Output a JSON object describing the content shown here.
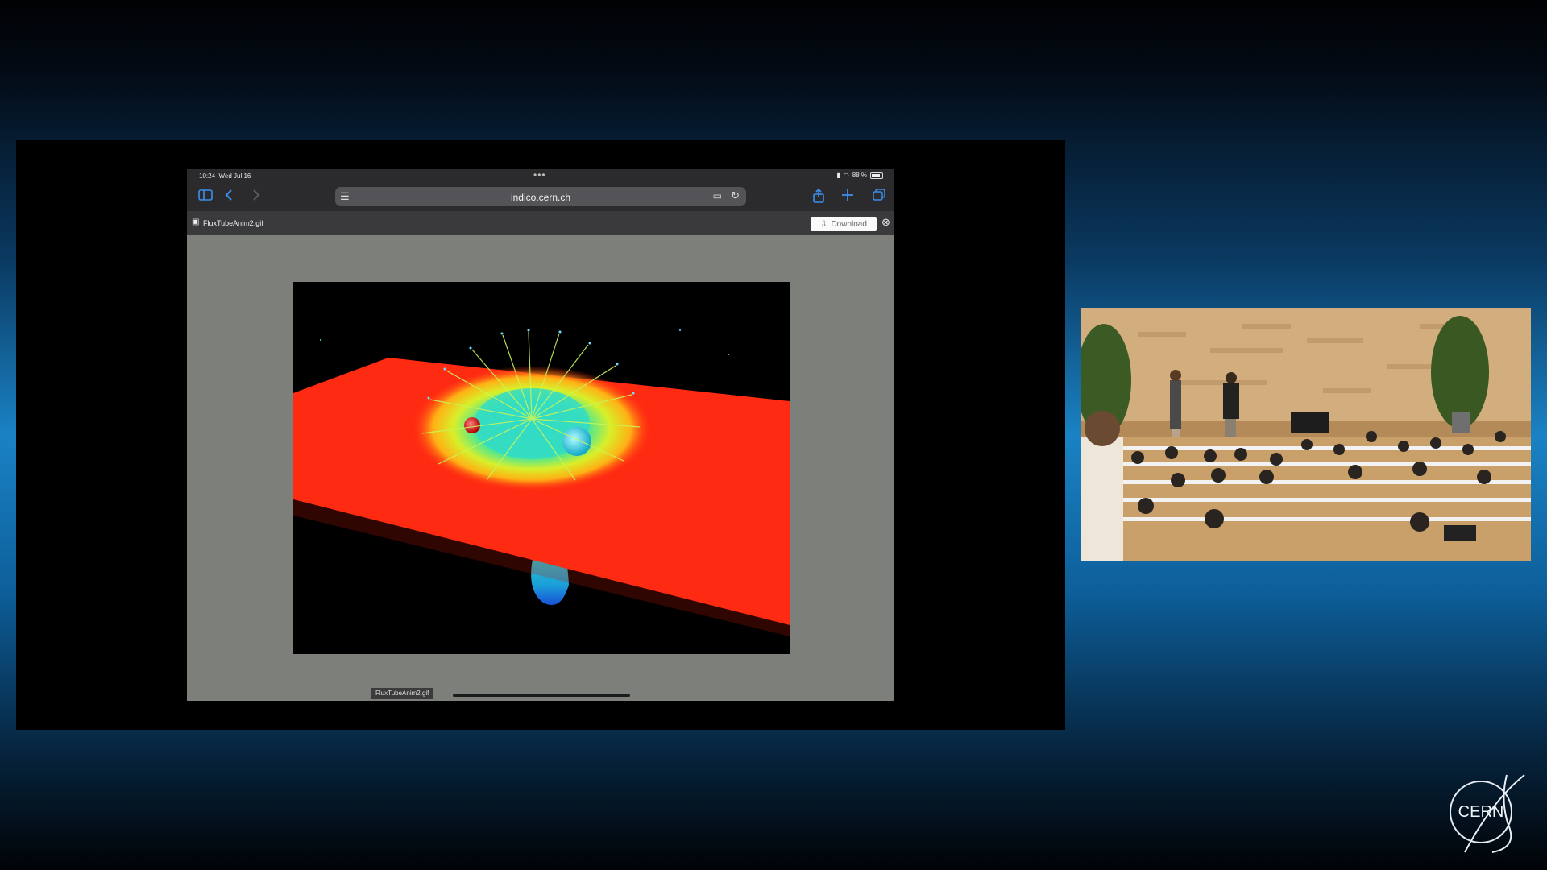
{
  "status_bar": {
    "time": "10:24",
    "date": "Wed Jul 16",
    "battery": "88 %"
  },
  "browser": {
    "url": "indico.cern.ch",
    "sidebar_icon": "sidebar-icon",
    "back_icon": "chevron-left-icon",
    "forward_icon": "chevron-right-icon",
    "share_icon": "share-icon",
    "new_tab_icon": "plus-icon",
    "tabs_icon": "tabs-icon"
  },
  "file_viewer": {
    "file_name": "FluxTubeAnim2.gif",
    "download_label": "Download",
    "caption": "FluxTubeAnim2.gif"
  },
  "branding": {
    "logo_text": "CERN"
  },
  "colors": {
    "accent": "#3d8ef0",
    "plane": "#ff2a12",
    "background_blue": "#1a82c4"
  }
}
